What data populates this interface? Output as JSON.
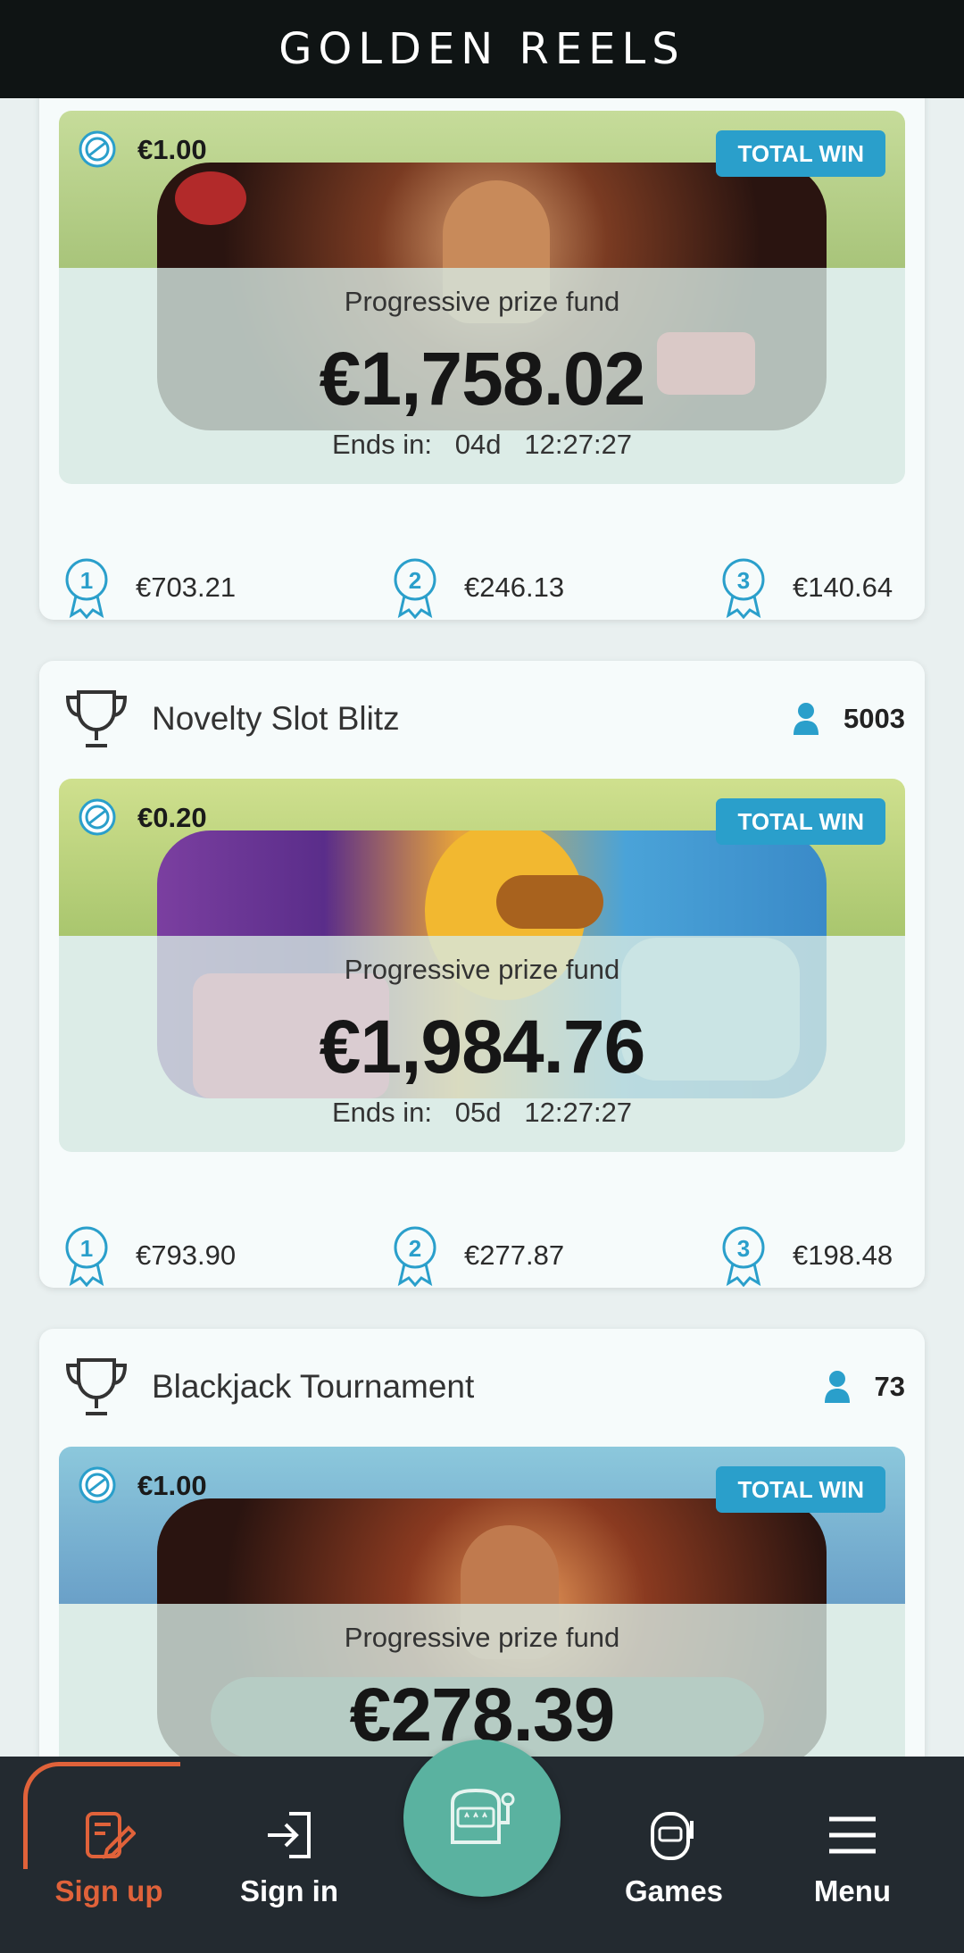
{
  "header": {
    "logo": "GOLDEN REELS"
  },
  "labels": {
    "total_win": "TOTAL WIN",
    "fund_label": "Progressive prize fund",
    "ends_prefix": "Ends in:"
  },
  "tournaments": [
    {
      "title": "",
      "players": "",
      "bet": "€1.00",
      "fund": "€1,758.02",
      "ends_days": "04d",
      "ends_time": "12:27:27",
      "prizes": [
        "€703.21",
        "€246.13",
        "€140.64"
      ]
    },
    {
      "title": "Novelty Slot Blitz",
      "players": "5003",
      "bet": "€0.20",
      "fund": "€1,984.76",
      "ends_days": "05d",
      "ends_time": "12:27:27",
      "prizes": [
        "€793.90",
        "€277.87",
        "€198.48"
      ]
    },
    {
      "title": "Blackjack Tournament",
      "players": "73",
      "bet": "€1.00",
      "fund": "€278.39"
    }
  ],
  "nav": {
    "signup": "Sign up",
    "signin": "Sign in",
    "games": "Games",
    "menu": "Menu"
  },
  "colors": {
    "accent": "#2a9fcb",
    "signup": "#e0623a",
    "nav_bg": "#232a30",
    "center_button": "#5ab2a0"
  }
}
